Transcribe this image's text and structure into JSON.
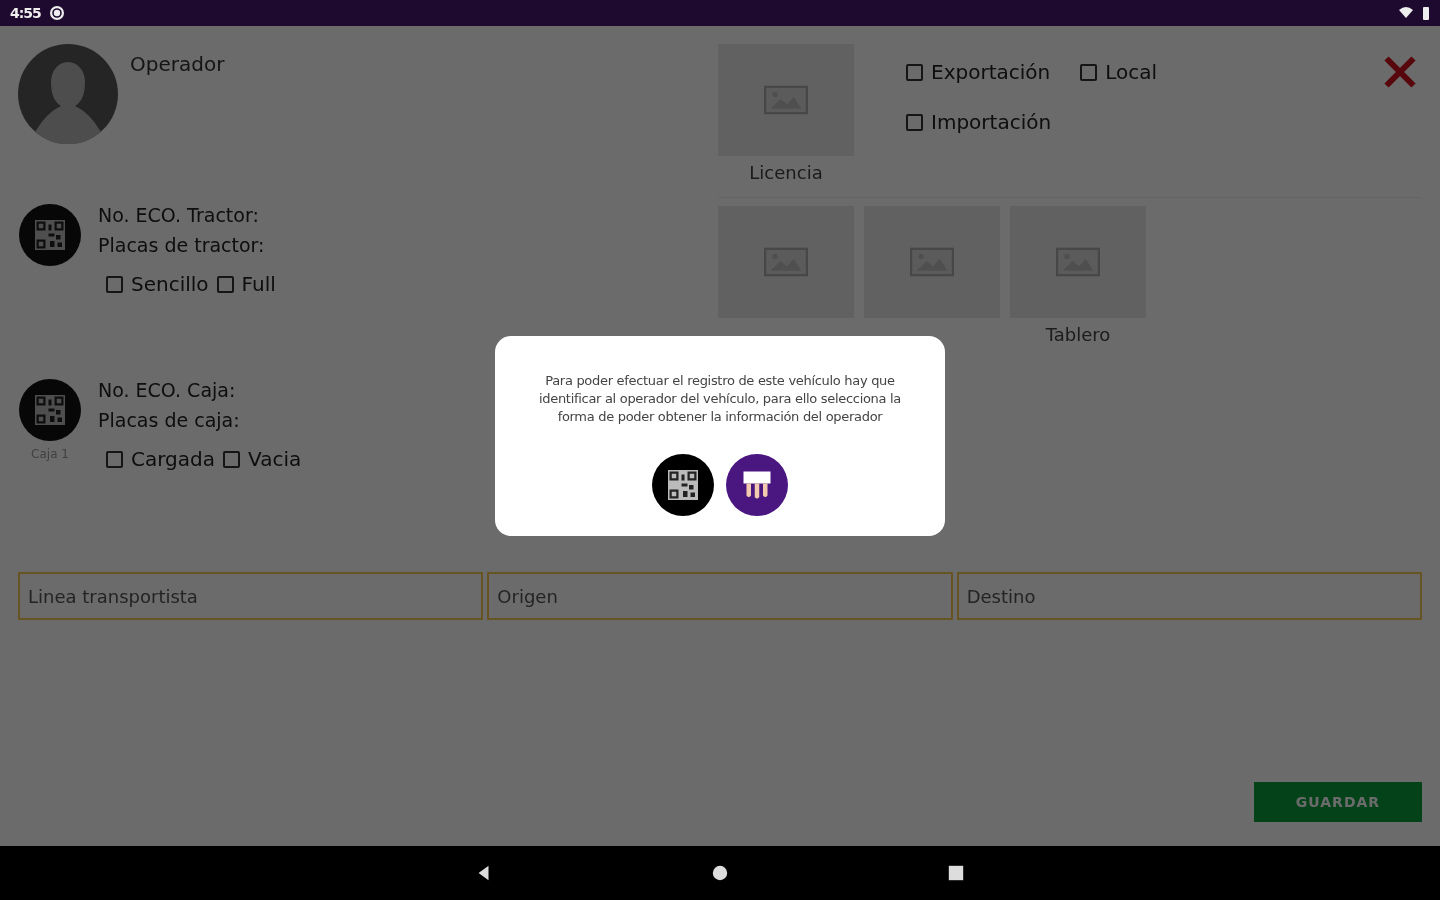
{
  "status_bar": {
    "time": "4:55"
  },
  "operator": {
    "label": "Operador"
  },
  "license": {
    "label": "Licencia"
  },
  "trade_options": [
    {
      "label": "Exportación",
      "checked": false
    },
    {
      "label": "Local",
      "checked": false
    },
    {
      "label": "Importación",
      "checked": false
    }
  ],
  "tractor": {
    "lines": [
      "No. ECO. Tractor:",
      "Placas de tractor:"
    ],
    "options": [
      {
        "label": "Sencillo",
        "checked": false
      },
      {
        "label": "Full",
        "checked": false
      }
    ]
  },
  "photos": [
    {
      "kind": "unlabeled"
    },
    {
      "kind": "unlabeled"
    },
    {
      "kind": "labeled",
      "label": "Tablero"
    }
  ],
  "box": {
    "caption": "Caja 1",
    "lines": [
      "No. ECO. Caja:",
      "Placas de caja:"
    ],
    "options": [
      {
        "label": "Cargada",
        "checked": false
      },
      {
        "label": "Vacia",
        "checked": false
      }
    ]
  },
  "fields": [
    {
      "placeholder": "Linea transportista"
    },
    {
      "placeholder": "Origen"
    },
    {
      "placeholder": "Destino"
    }
  ],
  "save_button": "GUARDAR",
  "dialog": {
    "message": "Para poder efectuar el registro de este vehículo hay que identificar al operador del vehículo, para ello selecciona la forma de poder obtener la información del operador",
    "options": [
      {
        "kind": "qr"
      },
      {
        "kind": "fingerprint"
      }
    ]
  }
}
